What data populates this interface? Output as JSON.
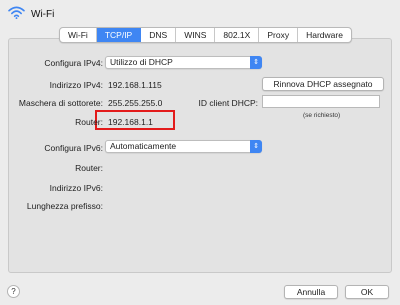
{
  "window": {
    "title": "Wi-Fi",
    "icon": "wifi-icon"
  },
  "tabs": [
    {
      "label": "Wi-Fi",
      "active": false
    },
    {
      "label": "TCP/IP",
      "active": true
    },
    {
      "label": "DNS",
      "active": false
    },
    {
      "label": "WINS",
      "active": false
    },
    {
      "label": "802.1X",
      "active": false
    },
    {
      "label": "Proxy",
      "active": false
    },
    {
      "label": "Hardware",
      "active": false
    }
  ],
  "ipv4": {
    "configure_label": "Configura IPv4:",
    "configure_value": "Utilizzo di DHCP",
    "address_label": "Indirizzo IPv4:",
    "address_value": "192.168.1.115",
    "renew_button": "Rinnova DHCP assegnato",
    "subnet_label": "Maschera di sottorete:",
    "subnet_value": "255.255.255.0",
    "dhcp_client_label": "ID client DHCP:",
    "dhcp_client_value": "",
    "dhcp_client_hint": "(se richiesto)",
    "router_label": "Router:",
    "router_value": "192.168.1.1"
  },
  "ipv6": {
    "configure_label": "Configura IPv6:",
    "configure_value": "Automaticamente",
    "router_label": "Router:",
    "address_label": "Indirizzo IPv6:",
    "prefix_label": "Lunghezza prefisso:"
  },
  "footer": {
    "help_label": "?",
    "cancel_label": "Annulla",
    "ok_label": "OK"
  },
  "colors": {
    "accent": "#3f86f3",
    "highlight": "#e31b1b"
  }
}
